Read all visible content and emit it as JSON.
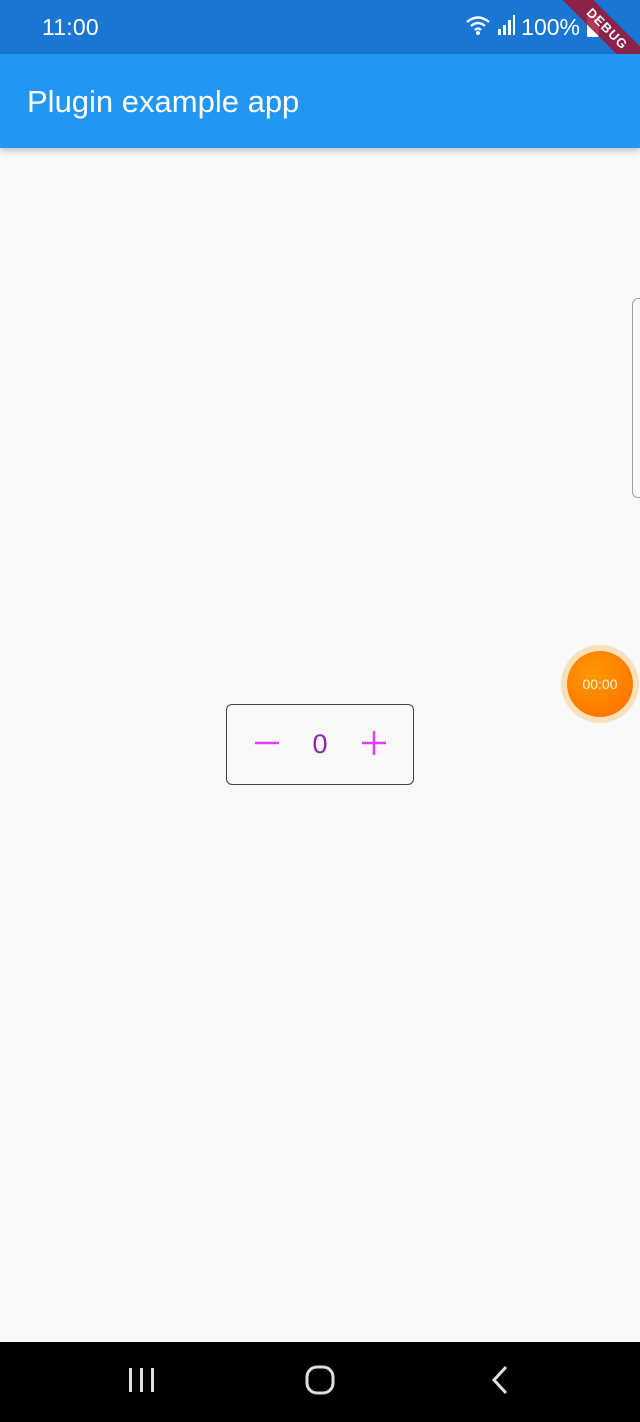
{
  "status_bar": {
    "time": "11:00",
    "battery_percent": "100%",
    "icons": [
      "wifi-icon",
      "signal-icon",
      "battery-icon"
    ]
  },
  "debug_banner": {
    "label": "DEBUG"
  },
  "app_bar": {
    "title": "Plugin example app"
  },
  "floating_timer": {
    "label": "00:00"
  },
  "stepper": {
    "value": "0",
    "decrement_icon": "minus-icon",
    "increment_icon": "plus-icon",
    "accent_color": "#e040fb",
    "value_color": "#8e24aa"
  },
  "nav_bar": {
    "items": [
      "recents-icon",
      "home-icon",
      "back-icon"
    ]
  },
  "colors": {
    "status_bar": "#1976d2",
    "app_bar": "#2196f3",
    "background": "#f9f9f9",
    "timer": "#ff6d00"
  }
}
